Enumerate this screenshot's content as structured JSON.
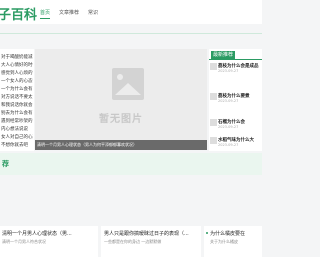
{
  "header": {
    "logo_text": "子百科",
    "nav": [
      "首页",
      "文章推荐",
      "常识"
    ]
  },
  "sidebar": {
    "items": [
      "对于喝酸奶能减",
      "大人心情好的时候",
      "感觉到人心烦的说说",
      "一个女人的心态让",
      "一个为什么会有",
      "对方说话不要太",
      "和我说话你就会",
      "别去为什么会有",
      "遇到经常吵架的",
      "内心想法说说",
      "女人对自己的心态",
      "不想你就去吧"
    ]
  },
  "banner": {
    "placeholder_text": "暂无图片",
    "caption": "清明一个月男人心理状态（男人为何平添郁郁寡欢状况）"
  },
  "right": {
    "tag": "最新推荐",
    "items": [
      {
        "title": "荔枝为什么会是成品",
        "sub": "2023-09-27"
      },
      {
        "title": "荔枝为什么要煮",
        "sub": "2023-09-27"
      },
      {
        "title": "石榴为什么会",
        "sub": "2023-09-27"
      },
      {
        "title": "水稻气味为什么大",
        "sub": "2023-09-27"
      }
    ]
  },
  "section": {
    "title": "荐"
  },
  "cards": [
    {
      "title": "清明一个月男人心理状态（男...",
      "desc": "清明一个月男人符合状况"
    },
    {
      "title": "男人只是跟你搞暧昧过日子的表现（...",
      "desc": "一些都是在你的身边 一边默默做"
    },
    {
      "title": "为什么橘皮要在",
      "desc": "关于为什么橘皮"
    }
  ]
}
